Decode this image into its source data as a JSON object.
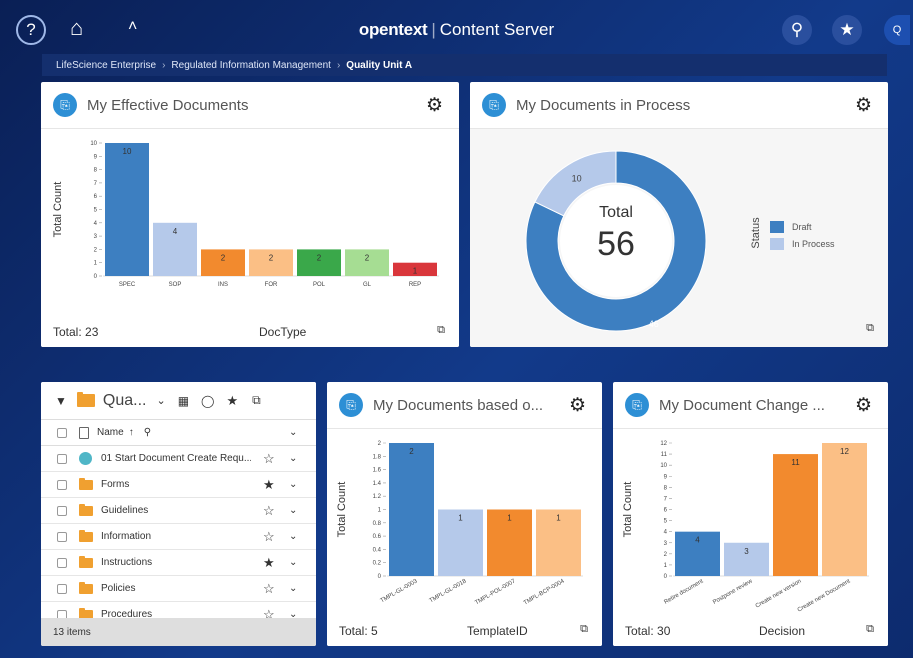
{
  "app": {
    "brand": "opentext",
    "product": "Content Server"
  },
  "topbar": {
    "help_icon": "?",
    "home_icon": "⌂",
    "up_icon": "˄",
    "search_icon": "⚲",
    "fav_icon": "★",
    "user_initial": "Q"
  },
  "breadcrumb": {
    "items": [
      "LifeScience Enterprise",
      "Regulated Information Management"
    ],
    "current": "Quality Unit A"
  },
  "panels": {
    "effective": {
      "title": "My Effective Documents",
      "total": "Total: 23",
      "xlabel": "DocType",
      "ylabel": "Total Count"
    },
    "process": {
      "title": "My Documents in Process",
      "center_label": "Total",
      "center_value": "56",
      "legend_title": "Status"
    },
    "based": {
      "title": "My Documents based o...",
      "total": "Total: 5",
      "xlabel": "TemplateID",
      "ylabel": "Total Count"
    },
    "change": {
      "title": "My Document Change ...",
      "total": "Total: 30",
      "xlabel": "Decision",
      "ylabel": "Total Count"
    }
  },
  "list": {
    "folder_title": "Qua...",
    "header": {
      "name": "Name",
      "sort": "↑"
    },
    "rows": [
      {
        "name": "01 Start Document Create Requ...",
        "fav": "☆",
        "type": "workflow"
      },
      {
        "name": "Forms",
        "fav": "★",
        "type": "folder"
      },
      {
        "name": "Guidelines",
        "fav": "☆",
        "type": "folder"
      },
      {
        "name": "Information",
        "fav": "☆",
        "type": "folder"
      },
      {
        "name": "Instructions",
        "fav": "★",
        "type": "folder"
      },
      {
        "name": "Policies",
        "fav": "☆",
        "type": "folder"
      },
      {
        "name": "Procedures",
        "fav": "☆",
        "type": "folder"
      }
    ],
    "footer": "13 items"
  },
  "chart_data": [
    {
      "type": "bar",
      "title": "My Effective Documents",
      "xlabel": "DocType",
      "ylabel": "Total Count",
      "categories": [
        "SPEC",
        "SOP",
        "INS",
        "FOR",
        "POL",
        "GL",
        "REP"
      ],
      "values": [
        10,
        4,
        2,
        2,
        2,
        2,
        1
      ],
      "colors": [
        "#3d7fc1",
        "#b5c9ea",
        "#f28a2e",
        "#fbbf85",
        "#3aa84a",
        "#a6dd93",
        "#d9363b"
      ],
      "ylim": [
        0,
        10
      ],
      "yticks": [
        0,
        1,
        2,
        3,
        4,
        5,
        6,
        7,
        8,
        9,
        10
      ]
    },
    {
      "type": "pie",
      "title": "My Documents in Process",
      "legend_title": "Status",
      "categories": [
        "Draft",
        "In Process"
      ],
      "values": [
        46,
        10
      ],
      "colors": [
        "#3d7fc1",
        "#b5c9ea"
      ],
      "legend": "right"
    },
    {
      "type": "bar",
      "title": "My Documents based o...",
      "xlabel": "TemplateID",
      "ylabel": "Total Count",
      "categories": [
        "TMPL-GL-0003",
        "TMPL-GL-0018",
        "TMPL-POL-0007",
        "TMPL-BCP-0004"
      ],
      "values": [
        2,
        1,
        1,
        1
      ],
      "colors": [
        "#3d7fc1",
        "#b5c9ea",
        "#f28a2e",
        "#fbbf85"
      ],
      "ylim": [
        0,
        2
      ],
      "yticks": [
        0,
        0.2,
        0.4,
        0.6,
        0.8,
        1,
        1.2,
        1.4,
        1.6,
        1.8,
        2
      ]
    },
    {
      "type": "bar",
      "title": "My Document Change ...",
      "xlabel": "Decision",
      "ylabel": "Total Count",
      "categories": [
        "Retire document",
        "Postpone review",
        "Create new version",
        "Create new Document"
      ],
      "values": [
        4,
        3,
        11,
        12
      ],
      "colors": [
        "#3d7fc1",
        "#b5c9ea",
        "#f28a2e",
        "#fbbf85"
      ],
      "ylim": [
        0,
        12
      ],
      "yticks": [
        0,
        1,
        2,
        3,
        4,
        5,
        6,
        7,
        8,
        9,
        10,
        11,
        12
      ]
    }
  ]
}
